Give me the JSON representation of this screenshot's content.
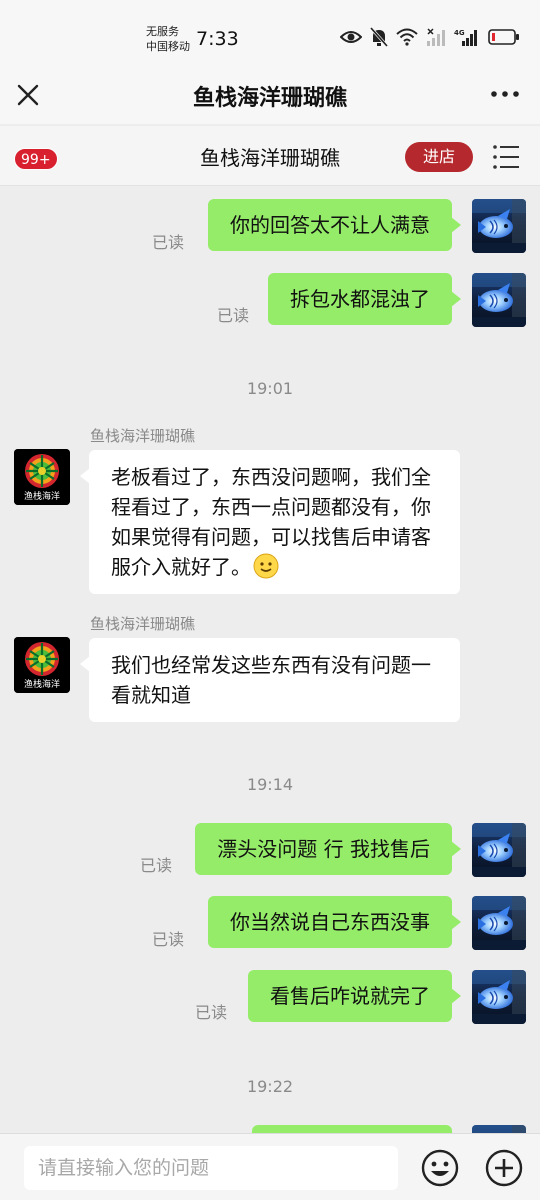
{
  "status_bar": {
    "carrier_line1": "无服务",
    "carrier_line2": "中国移动",
    "time": "7:33",
    "icons": [
      "eye-icon",
      "mute-bell-icon",
      "wifi-icon",
      "signal-icon",
      "4g-signal-icon",
      "battery-icon"
    ],
    "network_label": "4G"
  },
  "nav": {
    "title": "鱼栈海洋珊瑚礁",
    "close_icon": "close-icon",
    "more_icon": "more-icon"
  },
  "shop_bar": {
    "badge": "99+",
    "shop_name": "鱼栈海洋珊瑚礁",
    "enter_label": "进店",
    "menu_icon": "list-menu-icon"
  },
  "messages": [
    {
      "type": "out",
      "text": "你的回答太不让人满意",
      "status": "已读"
    },
    {
      "type": "out",
      "text": "拆包水都混浊了",
      "status": "已读"
    },
    {
      "type": "time",
      "text": "19:01"
    },
    {
      "type": "in",
      "sender": "鱼栈海洋珊瑚礁",
      "text": "老板看过了，东西没问题啊，我们全程看过了，东西一点问题都没有，你如果觉得有问题，可以找售后申请客服介入就好了。",
      "emoji": "smile-emoji"
    },
    {
      "type": "in",
      "sender": "鱼栈海洋珊瑚礁",
      "text": "我们也经常发这些东西有没有问题一看就知道"
    },
    {
      "type": "time",
      "text": "19:14"
    },
    {
      "type": "out",
      "text": "漂头没问题 行 我找售后",
      "status": "已读"
    },
    {
      "type": "out",
      "text": "你当然说自己东西没事",
      "status": "已读"
    },
    {
      "type": "out",
      "text": "看售后咋说就完了",
      "status": "已读"
    },
    {
      "type": "time",
      "text": "19:22"
    }
  ],
  "shop_avatar_text": "渔栈海洋",
  "input": {
    "placeholder": "请直接输入您的问题",
    "emoji_icon": "emoji-icon",
    "plus_icon": "plus-icon"
  },
  "colors": {
    "outgoing_bubble": "#95ec69",
    "incoming_bubble": "#ffffff",
    "badge": "#d8202f",
    "enter_button": "#b5282d",
    "background": "#ededed"
  }
}
